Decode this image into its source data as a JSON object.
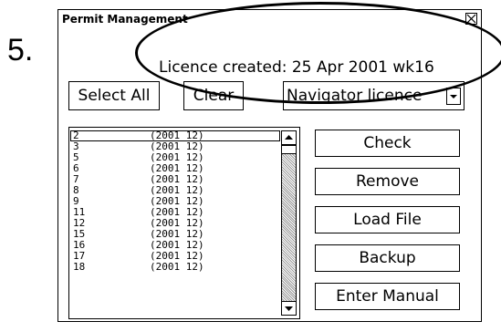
{
  "step_number": "5.",
  "window": {
    "title": "Permit Management"
  },
  "status": {
    "text": "Licence created: 25 Apr 2001  wk16"
  },
  "toolbar": {
    "select_all_label": "Select All",
    "clear_label": "Clear",
    "dropdown_value": "Navigator licence"
  },
  "list": {
    "rows": [
      {
        "id": "2",
        "version": "(2001  12)"
      },
      {
        "id": "3",
        "version": "(2001  12)"
      },
      {
        "id": "5",
        "version": "(2001  12)"
      },
      {
        "id": "6",
        "version": "(2001  12)"
      },
      {
        "id": "7",
        "version": "(2001  12)"
      },
      {
        "id": "8",
        "version": "(2001  12)"
      },
      {
        "id": "9",
        "version": "(2001  12)"
      },
      {
        "id": "11",
        "version": "(2001  12)"
      },
      {
        "id": "12",
        "version": "(2001  12)"
      },
      {
        "id": "15",
        "version": "(2001  12)"
      },
      {
        "id": "16",
        "version": "(2001  12)"
      },
      {
        "id": "17",
        "version": "(2001  12)"
      },
      {
        "id": "18",
        "version": "(2001  12)"
      }
    ]
  },
  "actions": {
    "check_label": "Check",
    "remove_label": "Remove",
    "load_file_label": "Load File",
    "backup_label": "Backup",
    "enter_manual_label": "Enter Manual"
  },
  "icons": {
    "close": "close-icon",
    "dropdown": "chevron-down-icon",
    "scroll_up": "arrow-up-icon",
    "scroll_down": "arrow-down-icon"
  }
}
